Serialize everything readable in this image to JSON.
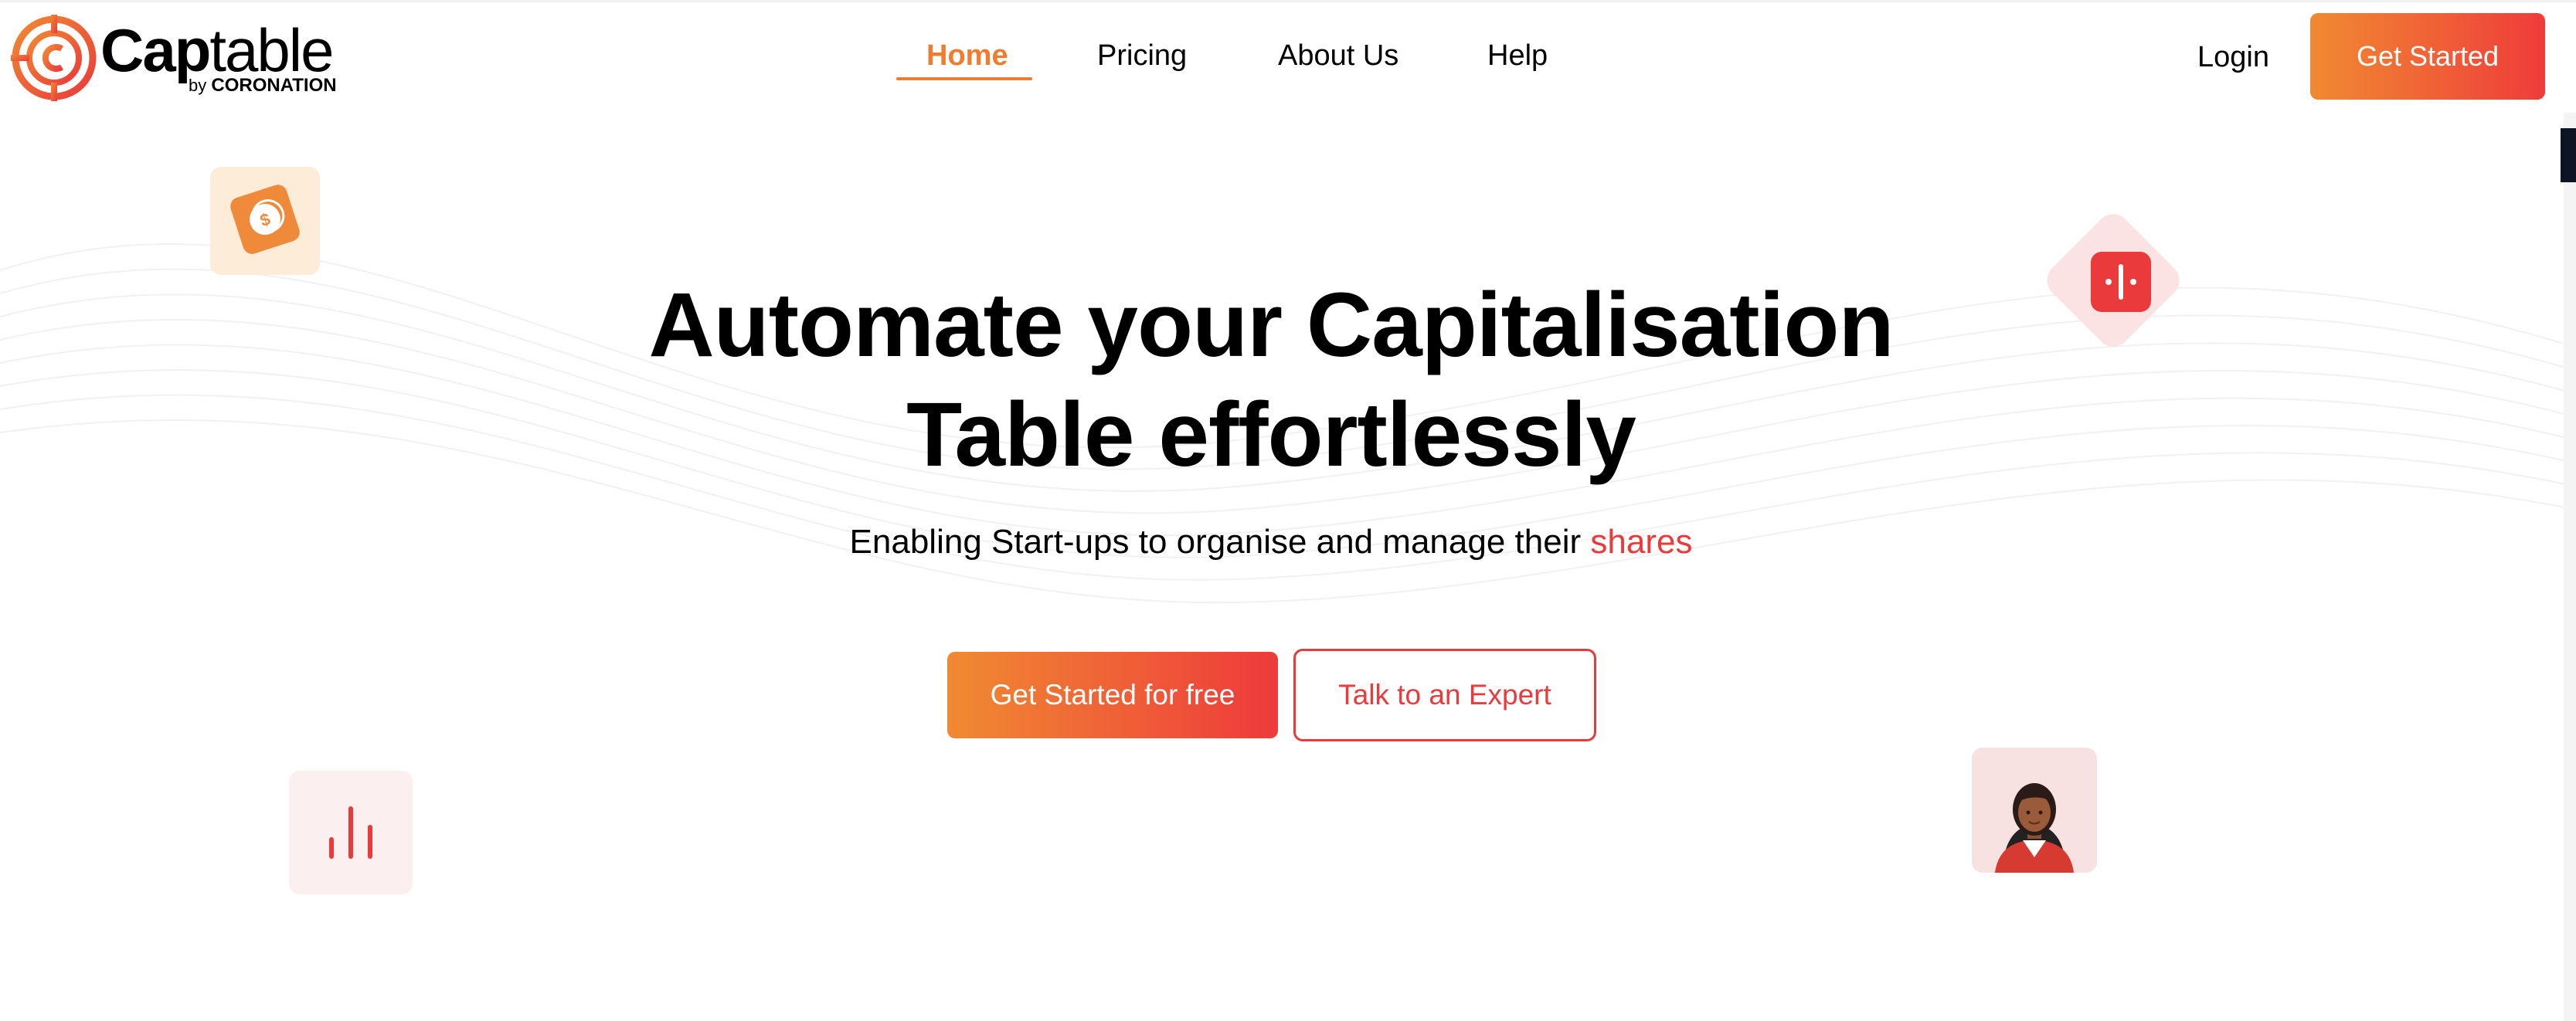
{
  "brand": {
    "name_strong": "Cap",
    "name_light": "table",
    "sub_prefix": "by",
    "sub_org": "CORONATION",
    "accent_orange": "#ef7d30",
    "accent_red": "#ea3a3c"
  },
  "nav": {
    "items": [
      {
        "label": "Home",
        "active": true
      },
      {
        "label": "Pricing",
        "active": false
      },
      {
        "label": "About Us",
        "active": false
      },
      {
        "label": "Help",
        "active": false
      }
    ],
    "login_label": "Login",
    "get_started_label": "Get Started"
  },
  "hero": {
    "title_line1": "Automate your Capitalisation",
    "title_line2": "Table effortlessly",
    "subtitle_prefix": "Enabling Start-ups to organise and manage their",
    "subtitle_accent": "shares",
    "primary_cta": "Get Started for free",
    "secondary_cta": "Talk to an Expert"
  },
  "decorations": {
    "coin_card": "dollar-coin-icon",
    "diamond_card": "split-icon",
    "bars_card": "bar-chart-icon",
    "avatar_card": "avatar"
  }
}
